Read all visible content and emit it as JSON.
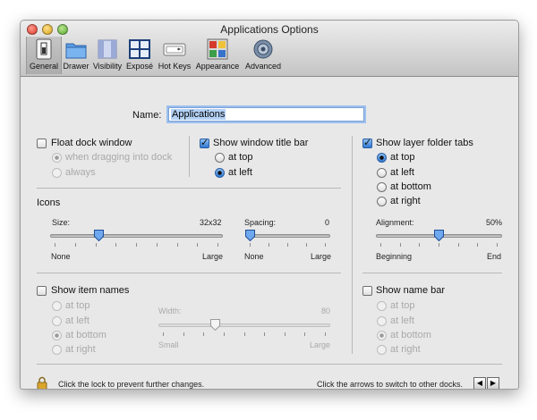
{
  "window": {
    "title": "Applications Options"
  },
  "toolbar": {
    "items": [
      {
        "label": "General",
        "icon": "general-switch-icon",
        "selected": true
      },
      {
        "label": "Drawer",
        "icon": "drawer-folder-icon"
      },
      {
        "label": "Visibility",
        "icon": "visibility-icon"
      },
      {
        "label": "Exposé",
        "icon": "expose-icon"
      },
      {
        "label": "Hot Keys",
        "icon": "hot-keys-icon"
      },
      {
        "label": "Appearance",
        "icon": "appearance-icon"
      },
      {
        "label": "Advanced",
        "icon": "gear-icon"
      }
    ]
  },
  "name": {
    "label": "Name:",
    "value": "Applications"
  },
  "float_dock": {
    "label": "Float dock window",
    "checked": false,
    "options": [
      {
        "label": "when dragging into dock",
        "selected": true
      },
      {
        "label": "always",
        "selected": false
      }
    ]
  },
  "window_title_bar": {
    "label": "Show window title bar",
    "checked": true,
    "options": [
      {
        "label": "at top",
        "selected": false
      },
      {
        "label": "at left",
        "selected": true
      }
    ]
  },
  "layer_folder_tabs": {
    "label": "Show layer folder tabs",
    "checked": true,
    "options": [
      {
        "label": "at top",
        "selected": true
      },
      {
        "label": "at left",
        "selected": false
      },
      {
        "label": "at bottom",
        "selected": false
      },
      {
        "label": "at right",
        "selected": false
      }
    ]
  },
  "icons": {
    "heading": "Icons",
    "size": {
      "label": "Size:",
      "value": "32x32",
      "min": "None",
      "max": "Large",
      "level": 0.27
    },
    "spacing": {
      "label": "Spacing:",
      "value": "0",
      "min": "None",
      "max": "Large",
      "level": 0.0
    }
  },
  "alignment": {
    "label": "Alignment:",
    "value": "50%",
    "min": "Beginning",
    "max": "End",
    "level": 0.5
  },
  "item_names": {
    "label": "Show item names",
    "checked": false,
    "options": [
      {
        "label": "at top",
        "selected": false
      },
      {
        "label": "at left",
        "selected": false
      },
      {
        "label": "at bottom",
        "selected": true
      },
      {
        "label": "at right",
        "selected": false
      }
    ],
    "width": {
      "label": "Width:",
      "value": "80",
      "min": "Small",
      "max": "Large",
      "level": 0.32
    }
  },
  "name_bar": {
    "label": "Show name bar",
    "checked": false,
    "options": [
      {
        "label": "at top",
        "selected": false
      },
      {
        "label": "at left",
        "selected": false
      },
      {
        "label": "at bottom",
        "selected": true
      },
      {
        "label": "at right",
        "selected": false
      }
    ]
  },
  "footer": {
    "lock_text": "Click the lock to prevent further changes.",
    "arrows_text": "Click the arrows to switch to other docks.",
    "prev_glyph": "◀",
    "next_glyph": "▶"
  },
  "colors": {
    "accent": "#2f78d2",
    "selection": "#b3d1f5",
    "window_bg": "#e8e8e8"
  }
}
